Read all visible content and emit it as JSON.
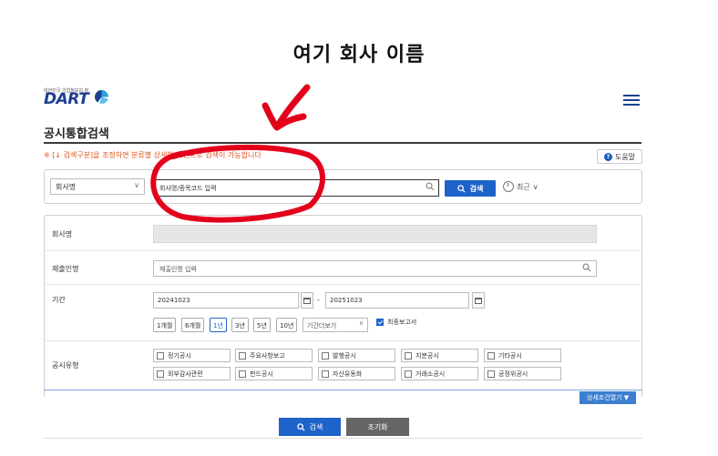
{
  "heading": "여기 회사 이름",
  "logo": {
    "tagline": "대한민국 기업정보의 창",
    "text": "DART"
  },
  "page_title": "공시통합검색",
  "notice": "※ [↓ 검색구분]을 조정하면 분류별    상세한 조건으로 검색이 가능합니다",
  "help_label": "도움말",
  "search": {
    "type_value": "회사명",
    "input_placeholder": "회사명/종목코드 입력",
    "button_label": "검색",
    "recent_label": "최근"
  },
  "form": {
    "company_label": "회사명",
    "submitter_label": "제출인명",
    "submitter_placeholder": "제출인명 입력",
    "period_label": "기간",
    "date_from": "20241023",
    "date_sep": "-",
    "date_to": "20251023",
    "periods": [
      "1개월",
      "6개월",
      "1년",
      "3년",
      "5년",
      "10년"
    ],
    "period_active": "1년",
    "period_more": "기간더보기",
    "final_report_label": "최종보고서",
    "disclosure_type_label": "공시유형",
    "disclosure_types": [
      "정기공시",
      "주요사항보고",
      "발행공시",
      "지분공시",
      "기타공시",
      "외부감사관련",
      "펀드공시",
      "자산유동화",
      "거래소공시",
      "공정위공시"
    ]
  },
  "advanced_label": "상세조건열기 ▼",
  "bottom_search_label": "검색",
  "reset_label": "초기화",
  "colors": {
    "brand": "#1d3f8f",
    "primary": "#1e63c9",
    "notice": "#e2541e",
    "annotation": "#e3001b"
  }
}
